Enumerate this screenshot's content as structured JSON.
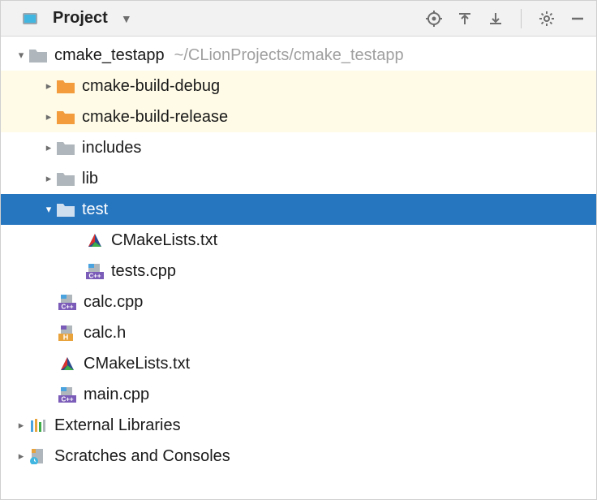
{
  "toolbar": {
    "title": "Project"
  },
  "tree": {
    "root": {
      "name": "cmake_testapp",
      "path": "~/CLionProjects/cmake_testapp"
    },
    "items": [
      {
        "name": "cmake-build-debug"
      },
      {
        "name": "cmake-build-release"
      },
      {
        "name": "includes"
      },
      {
        "name": "lib"
      },
      {
        "name": "test"
      },
      {
        "name": "CMakeLists.txt"
      },
      {
        "name": "tests.cpp"
      },
      {
        "name": "calc.cpp"
      },
      {
        "name": "calc.h"
      },
      {
        "name": "CMakeLists.txt"
      },
      {
        "name": "main.cpp"
      }
    ],
    "external": "External Libraries",
    "scratches": "Scratches and Consoles"
  }
}
